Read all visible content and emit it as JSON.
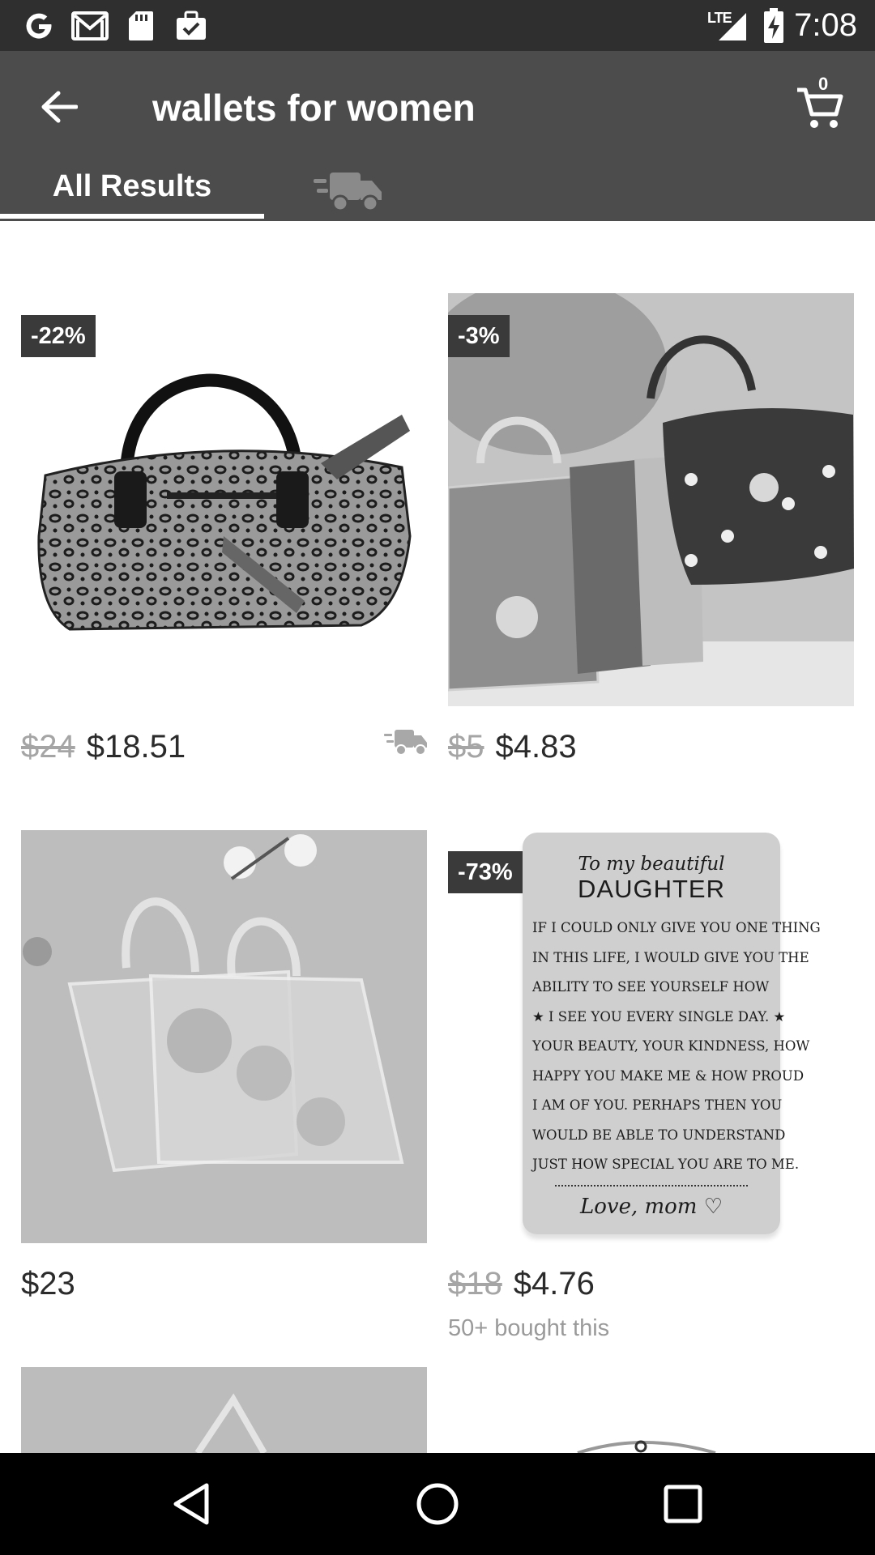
{
  "status_bar": {
    "time": "7:08",
    "network": "LTE",
    "icons": [
      "google-icon",
      "gmail-icon",
      "sd-card-icon",
      "briefcase-check-icon",
      "signal-icon",
      "battery-charging-icon"
    ]
  },
  "app_bar": {
    "search_query": "wallets for women",
    "cart_count": "0",
    "tabs": [
      {
        "label": "All Results",
        "selected": true
      },
      {
        "icon": "fast-shipping-truck-icon",
        "selected": false
      }
    ]
  },
  "products": [
    {
      "discount": "-22%",
      "original_price": "$24",
      "price": "$18.51",
      "fast_shipping": true,
      "image": "leopard-print-handbag"
    },
    {
      "discount": "-3%",
      "original_price": "$5",
      "price": "$4.83",
      "fast_shipping": false,
      "image": "cartoon-mini-tote-bags"
    },
    {
      "discount": "",
      "original_price": "",
      "price": "$23",
      "fast_shipping": false,
      "image": "clear-floral-gift-bags"
    },
    {
      "discount": "-73%",
      "original_price": "$18",
      "price": "$4.76",
      "bought": "50+ bought this",
      "fast_shipping": false,
      "image": "daughter-wallet-card"
    }
  ],
  "card_text": {
    "heading_small": "To my beautiful",
    "heading_big": "DAUGHTER",
    "lines": [
      "IF I COULD ONLY GIVE YOU ONE THING",
      "IN THIS LIFE, I WOULD GIVE YOU THE",
      "ABILITY TO SEE YOURSELF HOW",
      "★  I SEE YOU EVERY SINGLE DAY.  ★",
      "YOUR BEAUTY, YOUR KINDNESS, HOW",
      "HAPPY YOU MAKE ME & HOW PROUD",
      "I AM OF YOU. PERHAPS THEN YOU",
      "WOULD BE ABLE TO UNDERSTAND",
      "JUST HOW SPECIAL YOU ARE TO ME."
    ],
    "signature": "Love, mom ♡"
  },
  "nav_bar": {
    "buttons": [
      "back-triangle-icon",
      "home-circle-icon",
      "recents-square-icon"
    ]
  },
  "colors": {
    "status_bar": "#2f2f2f",
    "app_bar": "#4c4c4c",
    "badge": "#3a3a3a",
    "price": "#2b2b2b",
    "strikethrough": "#a5a5a5",
    "nav_bar": "#000000"
  }
}
